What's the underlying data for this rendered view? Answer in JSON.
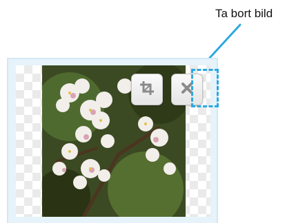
{
  "annotation": {
    "label": "Ta bort bild",
    "accent_color": "#2aa9e0"
  },
  "image_editor": {
    "crop_button": {
      "icon": "crop-icon"
    },
    "remove_button": {
      "icon": "close-icon"
    }
  }
}
